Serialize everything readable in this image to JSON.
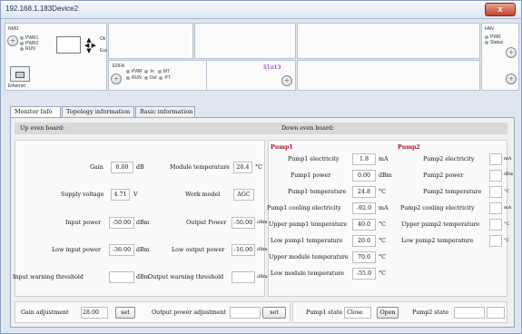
{
  "window": {
    "title": "192.168.1.183Device2",
    "close_label": "x"
  },
  "header": {
    "nmu": {
      "title": "NMU",
      "leds": [
        "PWR1",
        "PWR2",
        "RUN"
      ],
      "ok_label": "Ok",
      "esc_label": "Esc",
      "ethernet_label": "Ethernet"
    },
    "edfa": {
      "title": "EDFA",
      "leds_row1": [
        "PWR",
        "In",
        "MT"
      ],
      "leds_row2": [
        "RUN",
        "Out",
        "PT"
      ],
      "port_in": "in",
      "port_out": "out"
    },
    "slot_label": "Slot3",
    "fan": {
      "title": "FAN",
      "leds": [
        "PWR",
        "Status"
      ]
    }
  },
  "tabs": [
    "Monitor Info",
    "Topology information",
    "Basic information"
  ],
  "up_board": {
    "title": "Up even board:",
    "gain_label": "Gain",
    "gain_value": "0.00",
    "gain_unit": "dB",
    "module_temp_label": "Module temperature",
    "module_temp_value": "20.4",
    "module_temp_unit": "°C",
    "supply_label": "Supply voltage",
    "supply_value": "4.71",
    "supply_unit": "V",
    "work_model_label": "Work model",
    "work_model_value": "AGC",
    "input_power_label": "Input power",
    "input_power_value": "-50.00",
    "input_power_unit": "dBm",
    "output_power_label": "Output Power",
    "output_power_value": "-50.00",
    "output_power_unit": "dBm",
    "low_input_label": "Low input power",
    "low_input_value": "-36.00",
    "low_input_unit": "dBm",
    "low_output_label": "Low output power",
    "low_output_value": "-16.00",
    "low_output_unit": "dBm",
    "input_warn_label": "Input warning threshold",
    "input_warn_value": "",
    "input_warn_unit": "dBm",
    "output_warn_label": "Output warning threshold",
    "output_warn_value": "",
    "output_warn_unit": "dBm"
  },
  "down_board": {
    "title": "Down even board:",
    "pump1": {
      "title": "Pump1",
      "rows": [
        {
          "label": "Pump1 electricity",
          "value": "1.8",
          "unit": "mA"
        },
        {
          "label": "Pump1 power",
          "value": "0.00",
          "unit": "dBm"
        },
        {
          "label": "Pump1 temperature",
          "value": "24.8",
          "unit": "°C"
        },
        {
          "label": "Pump1 cooling electricity",
          "value": "-92.0",
          "unit": "mA"
        },
        {
          "label": "Upper pump1 temperature",
          "value": "40.0",
          "unit": "°C"
        },
        {
          "label": "Low pump1 temperature",
          "value": "20.0",
          "unit": "°C"
        },
        {
          "label": "Upper module temperature",
          "value": "70.0",
          "unit": "°C"
        },
        {
          "label": "Low module temperature",
          "value": "-55.0",
          "unit": "°C"
        }
      ]
    },
    "pump2": {
      "title": "Pump2",
      "rows": [
        {
          "label": "Pump2 electricity",
          "value": "",
          "unit": "mA"
        },
        {
          "label": "Pump2 power",
          "value": "",
          "unit": "dBm"
        },
        {
          "label": "Pump2 temperature",
          "value": "",
          "unit": "°C"
        },
        {
          "label": "Pump2 cooling electricity",
          "value": "",
          "unit": "mA"
        },
        {
          "label": "Upper pump2 temperature",
          "value": "",
          "unit": "°C"
        },
        {
          "label": "Low pump2 temperature",
          "value": "",
          "unit": "°C"
        }
      ]
    }
  },
  "bottom": {
    "gain_adj_label": "Gain adjustment",
    "gain_adj_value": "28.00",
    "set_label": "set",
    "out_power_adj_label": "Output power adjustment",
    "out_power_adj_value": "",
    "set2_label": "set",
    "pump1_state_label": "Pump1 state",
    "pump1_state_value": "Close",
    "open_label": "Open",
    "pump2_state_label": "Pump2 state",
    "pump2_state_value": ""
  }
}
